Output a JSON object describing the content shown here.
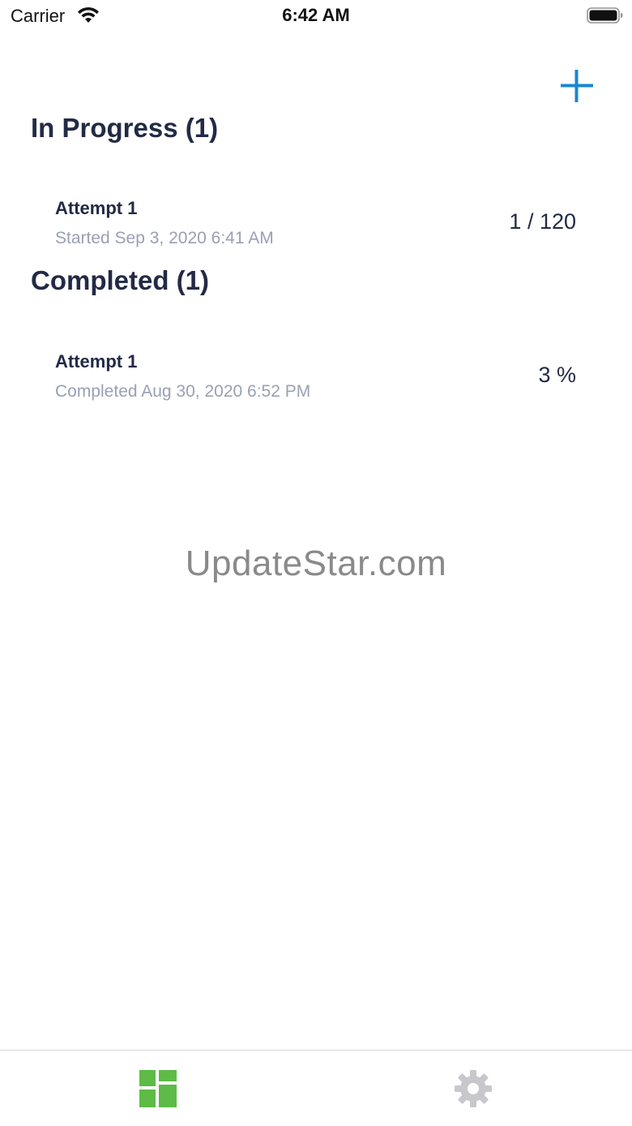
{
  "status_bar": {
    "carrier": "Carrier",
    "time": "6:42 AM",
    "wifi_icon": "wifi-icon",
    "battery_icon": "battery-icon"
  },
  "header": {
    "add_icon": "plus-icon",
    "accent_color": "#1a86d0"
  },
  "sections": [
    {
      "title": "In Progress (1)",
      "items": [
        {
          "title": "Attempt 1",
          "subtitle": "Started Sep 3, 2020 6:41 AM",
          "value": "1 / 120"
        }
      ]
    },
    {
      "title": "Completed (1)",
      "items": [
        {
          "title": "Attempt 1",
          "subtitle": "Completed Aug 30, 2020 6:52 PM",
          "value": "3 %"
        }
      ]
    }
  ],
  "watermark": "UpdateStar.com",
  "tab_bar": {
    "tabs": [
      {
        "icon": "dashboard-icon",
        "active": true,
        "color": "#5dbb46"
      },
      {
        "icon": "gear-icon",
        "active": false,
        "color": "#c7c7cc"
      }
    ]
  },
  "colors": {
    "heading": "#222a45",
    "subtitle": "#9aa0b4",
    "accent": "#1a86d0",
    "active_tab": "#5dbb46",
    "inactive_tab": "#c7c7cc"
  }
}
